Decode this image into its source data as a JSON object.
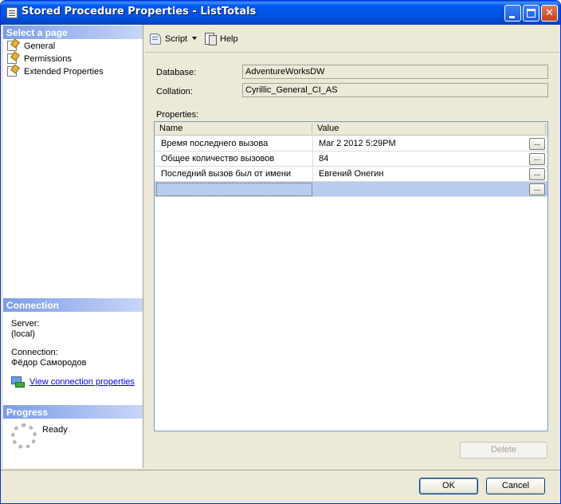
{
  "window": {
    "title": "Stored Procedure Properties - ListTotals",
    "controls": {
      "minimize": "minimize",
      "maximize": "maximize",
      "close": "✕"
    }
  },
  "left": {
    "select_page_header": "Select a page",
    "pages": [
      {
        "label": "General"
      },
      {
        "label": "Permissions"
      },
      {
        "label": "Extended Properties"
      }
    ],
    "connection_header": "Connection",
    "server_label": "Server:",
    "server_value": "(local)",
    "connection_label": "Connection:",
    "connection_value": "Фёдор Самородов",
    "view_connection_link": "View connection properties",
    "progress_header": "Progress",
    "progress_status": "Ready"
  },
  "toolbar": {
    "script_label": "Script",
    "help_label": "Help"
  },
  "form": {
    "database_label": "Database:",
    "database_value": "AdventureWorksDW",
    "collation_label": "Collation:",
    "collation_value": "Cyrillic_General_CI_AS",
    "properties_label": "Properties:"
  },
  "grid": {
    "columns": [
      "Name",
      "Value"
    ],
    "rows": [
      {
        "name": "Время последнего вызова",
        "value": "Mar  2 2012  5:29PM"
      },
      {
        "name": "Общее количество вызовов",
        "value": "84"
      },
      {
        "name": "Последний вызов был от имени",
        "value": "Евгений Онегин"
      },
      {
        "name": "",
        "value": ""
      }
    ],
    "ellipsis": "..."
  },
  "buttons": {
    "delete": "Delete",
    "ok": "OK",
    "cancel": "Cancel"
  }
}
